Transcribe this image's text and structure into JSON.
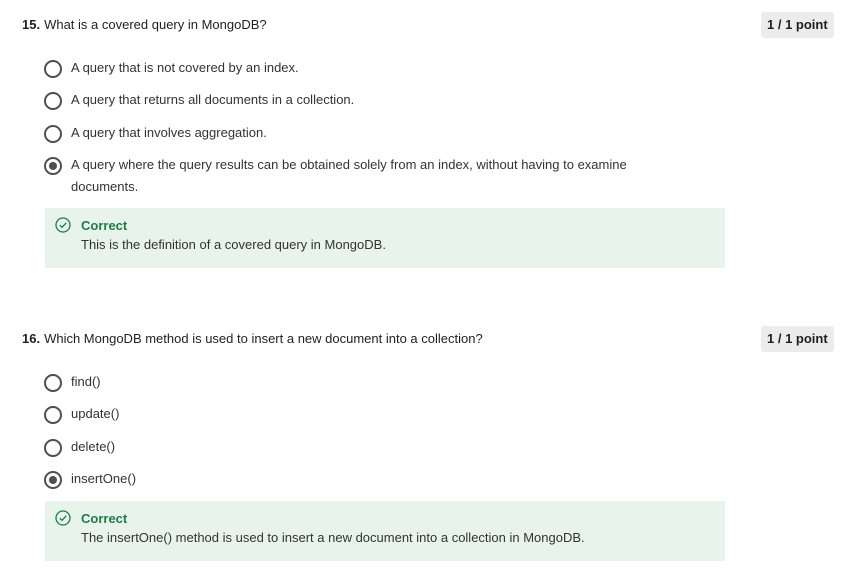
{
  "questions": [
    {
      "number": "15.",
      "text": "What is a covered query in MongoDB?",
      "points": "1 / 1 point",
      "options": [
        {
          "label": "A query that is not covered by an index.",
          "selected": false
        },
        {
          "label": "A query that returns all documents in a collection.",
          "selected": false
        },
        {
          "label": "A query that involves aggregation.",
          "selected": false
        },
        {
          "label": "A query where the query results can be obtained solely from an index, without having to examine documents.",
          "selected": true
        }
      ],
      "feedback": {
        "title": "Correct",
        "body": "This is the definition of a covered query in MongoDB."
      }
    },
    {
      "number": "16.",
      "text": "Which MongoDB method is used to insert a new document into a collection?",
      "points": "1 / 1 point",
      "options": [
        {
          "label": "find()",
          "selected": false
        },
        {
          "label": "update()",
          "selected": false
        },
        {
          "label": "delete()",
          "selected": false
        },
        {
          "label": "insertOne()",
          "selected": true
        }
      ],
      "feedback": {
        "title": "Correct",
        "body": "The insertOne() method is used to insert a new document into a collection in MongoDB."
      }
    }
  ],
  "colors": {
    "correct": "#1e7b4b",
    "feedback_bg": "#e8f3ec",
    "badge_bg": "#ececec"
  },
  "icons": {
    "feedback": "check-circle-icon"
  }
}
